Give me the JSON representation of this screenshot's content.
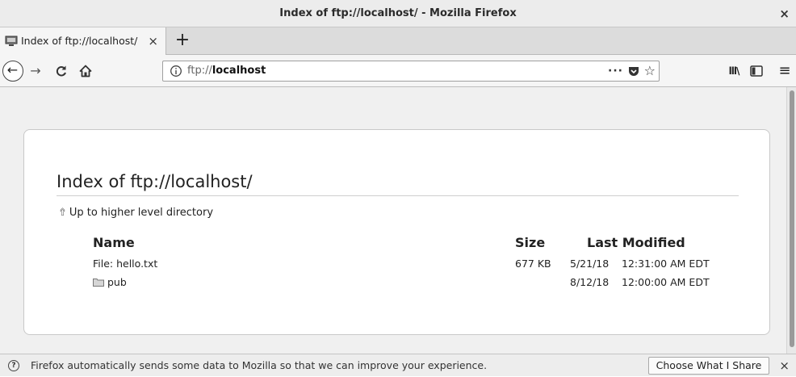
{
  "window": {
    "title": "Index of ftp://localhost/ - Mozilla Firefox",
    "close_glyph": "×"
  },
  "tabs": [
    {
      "label": "Index of ftp://localhost/",
      "close_glyph": "×",
      "icon": "computer-icon"
    }
  ],
  "new_tab_glyph": "+",
  "navbar": {
    "back_glyph": "←",
    "forward_glyph": "→",
    "reload_glyph": "C",
    "home_icon": "home-icon",
    "url_prefix": "ftp://",
    "url_host": "localhost",
    "page_actions_glyph": "···",
    "star_glyph": "☆",
    "library_glyph": "lll\\",
    "menu_glyph": "≡"
  },
  "page": {
    "heading": "Index of ftp://localhost/",
    "up_link": "Up to higher level directory",
    "columns": {
      "name": "Name",
      "size": "Size",
      "modified": "Last Modified"
    },
    "rows": [
      {
        "name": "File: hello.txt",
        "type": "file",
        "size": "677 KB",
        "date": "5/21/18",
        "time": "12:31:00 AM EDT"
      },
      {
        "name": "pub",
        "type": "folder",
        "size": "",
        "date": "8/12/18",
        "time": "12:00:00 AM EDT"
      }
    ]
  },
  "notification": {
    "icon": "?",
    "text": "Firefox automatically sends some data to Mozilla so that we can improve your experience.",
    "button": "Choose What I Share",
    "close_glyph": "×"
  }
}
